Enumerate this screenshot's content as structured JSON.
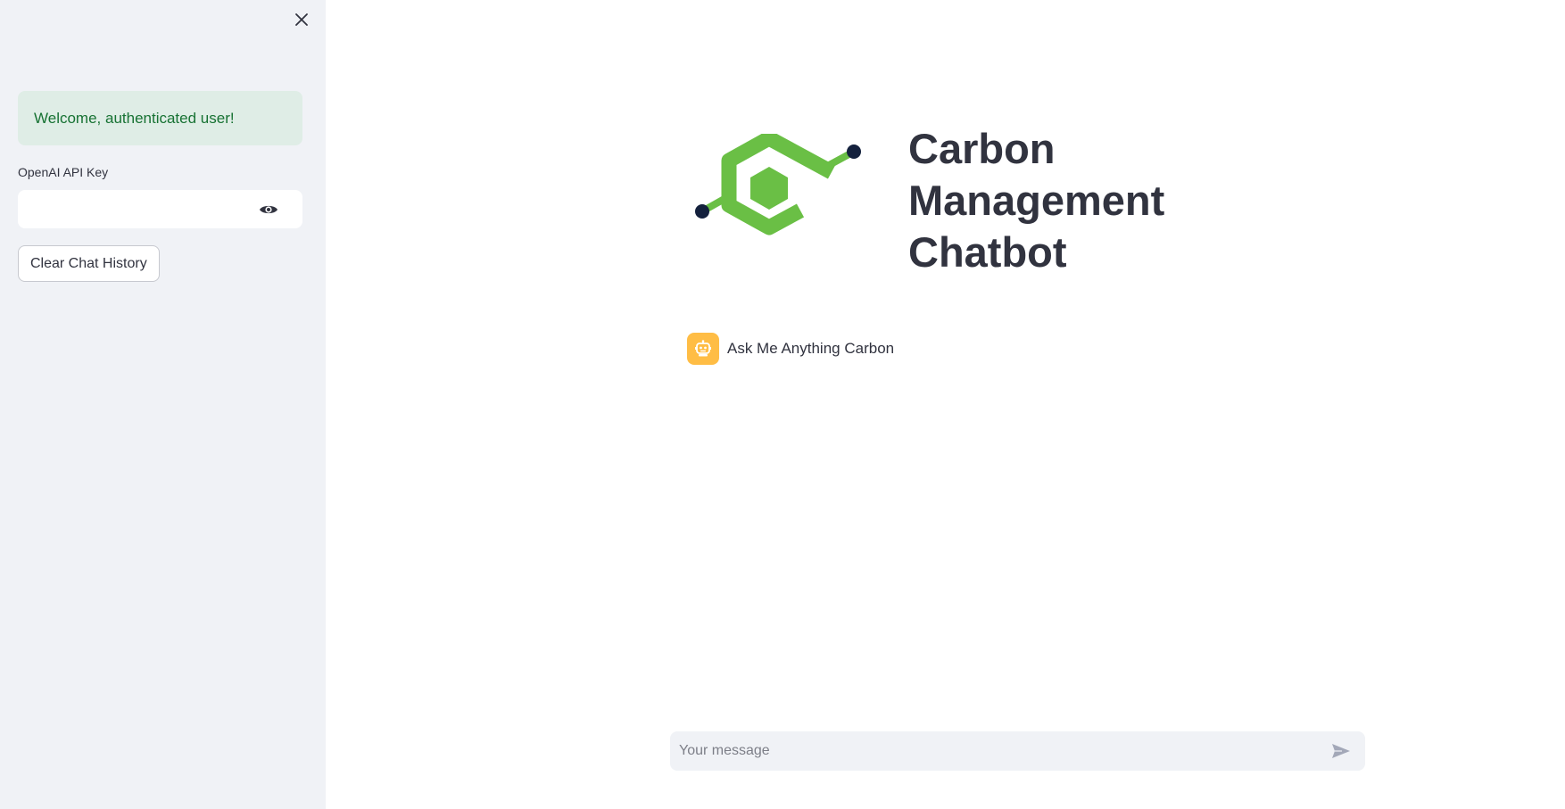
{
  "sidebar": {
    "close_icon": "close-icon",
    "welcome_message": "Welcome, authenticated user!",
    "api_key": {
      "label": "OpenAI API Key",
      "value": "",
      "placeholder": "",
      "toggle_icon": "eye-icon"
    },
    "clear_button_label": "Clear Chat History"
  },
  "main": {
    "logo_icon": "carbon-logo",
    "title": "Carbon Management Chatbot",
    "messages": [
      {
        "role": "assistant",
        "avatar_icon": "robot-icon",
        "text": "Ask Me Anything Carbon"
      }
    ],
    "chat_input": {
      "placeholder": "Your message",
      "send_icon": "send-icon"
    }
  },
  "colors": {
    "sidebar_bg": "#f0f2f6",
    "success_bg": "#dfede6",
    "success_text": "#177233",
    "logo_green": "#6abf45",
    "logo_dot": "#14213d",
    "avatar_bg": "#ffbd45",
    "text": "#31333f"
  }
}
